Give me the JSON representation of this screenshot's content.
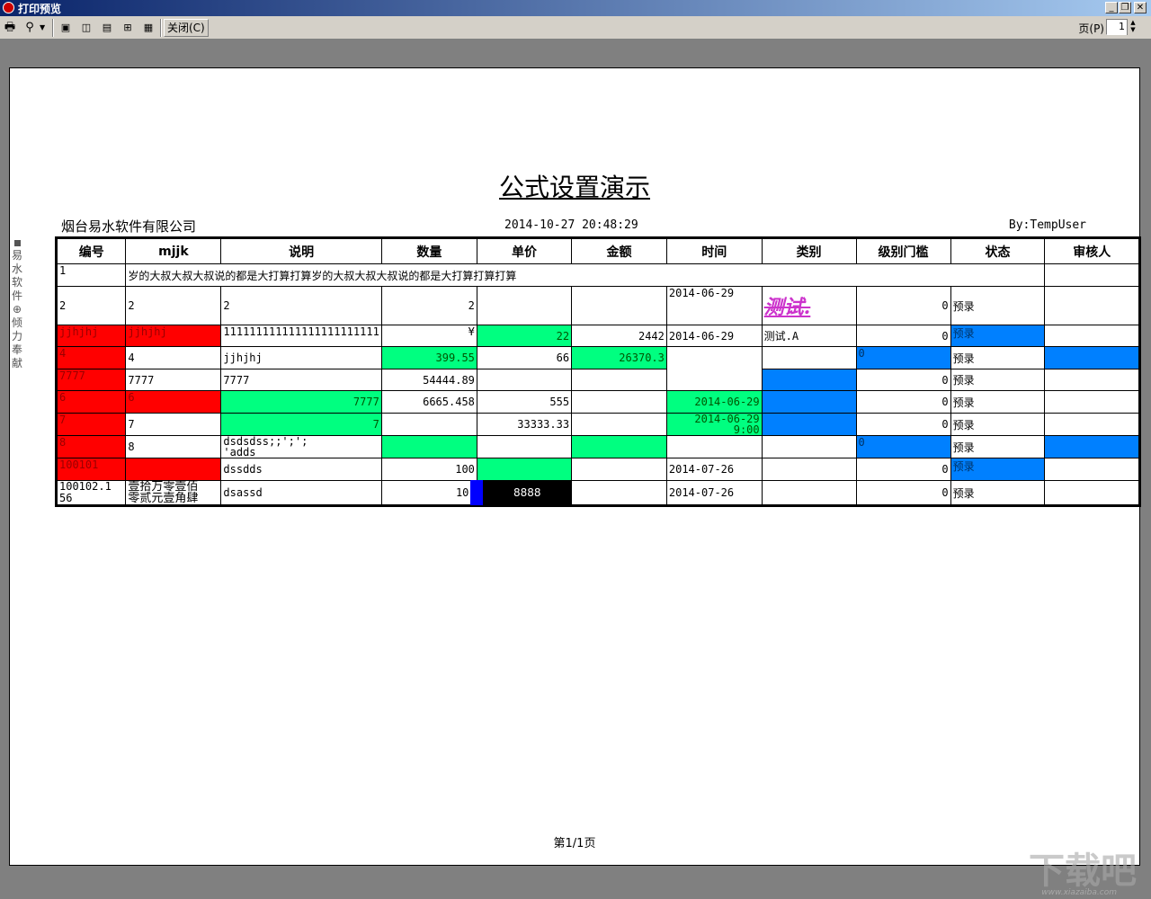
{
  "window": {
    "title": "打印预览",
    "min": "_",
    "restore": "❐",
    "close": "✕"
  },
  "toolbar": {
    "close_label": "关闭(C)",
    "page_label": "页(P)",
    "page_value": "1"
  },
  "report": {
    "title": "公式设置演示",
    "company": "烟台易水软件有限公司",
    "datetime": "2014-10-27 20:48:29",
    "user": "By:TempUser",
    "side_text": [
      "易",
      "水",
      "软",
      "件",
      "⊕",
      "倾",
      "力",
      "奉",
      "献"
    ],
    "footer": "第1/1页"
  },
  "table": {
    "headers": [
      "编号",
      "mjjk",
      "说明",
      "数量",
      "单价",
      "金额",
      "时间",
      "类别",
      "级别门槛",
      "状态",
      "审核人"
    ],
    "row1": {
      "c0": "1",
      "merged": "岁的大叔大叔大叔说的都是大打算打算岁的大叔大叔大叔说的都是大打算打算打算"
    },
    "row2": {
      "c0": "2",
      "c1": "2",
      "c2": "2",
      "c3": "2",
      "c6": "2014-06-29",
      "c7": "测试.",
      "c8": "0",
      "c9": "预录"
    },
    "row3": {
      "c0": "jjhjhj",
      "c1": "jjhjhj",
      "c2": "111111111111111111111111",
      "c3": "¥",
      "c4": "22",
      "c5": "2442",
      "c6": "2014-06-29",
      "c7": "测试.A",
      "c8": "0",
      "c9": "预录"
    },
    "row4": {
      "c0": "4",
      "c1": "4",
      "c2": "jjhjhj",
      "c3": "399.55",
      "c4": "66",
      "c5": "26370.3",
      "c8": "0",
      "c9": "预录"
    },
    "row5": {
      "c0": "7777",
      "c1": "7777",
      "c2": "7777",
      "c3": "54444.89",
      "c8": "0",
      "c9": "预录"
    },
    "row6": {
      "c0": "6",
      "c1": "6",
      "c2": "7777",
      "c3": "6665.458",
      "c4": "555",
      "c6": "2014-06-29",
      "c8": "0",
      "c9": "预录"
    },
    "row7": {
      "c0": "7",
      "c1": "7",
      "c2": "7",
      "c4": "33333.33",
      "c6a": "2014-06-29",
      "c6b": "9:00",
      "c8": "0",
      "c9": "预录"
    },
    "row8": {
      "c0": "8",
      "c1": "8",
      "c2a": "dsdsdss;;';';",
      "c2b": "'adds",
      "c8": "0",
      "c9": "预录"
    },
    "row9": {
      "c0": "100101",
      "c2": "dssdds",
      "c3": "100",
      "c6": "2014-07-26",
      "c8": "0",
      "c9": "预录"
    },
    "row10": {
      "c0a": "100102.1",
      "c0b": "56",
      "c1a": "壹拾万零壹佰",
      "c1b": "零贰元壹角肆",
      "c2": "dsassd",
      "c3": "10",
      "c4": "8888",
      "c6": "2014-07-26",
      "c8": "0",
      "c9": "预录"
    }
  },
  "watermark": {
    "text": "下载吧",
    "url": "www.xiazaiba.com"
  }
}
